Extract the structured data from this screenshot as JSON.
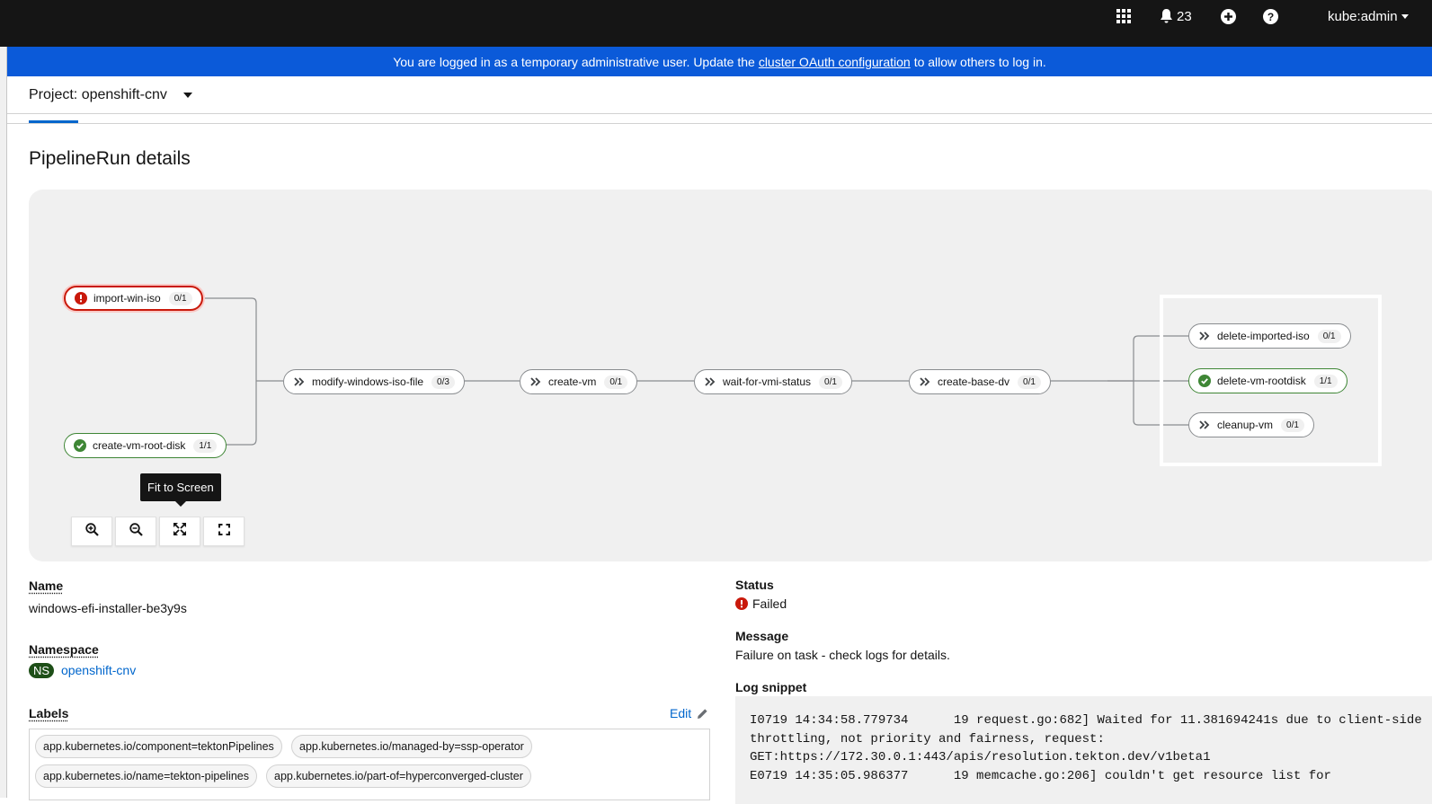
{
  "masthead": {
    "notifications_count": "23",
    "user": "kube:admin",
    "icons": [
      "app-launcher-icon",
      "bell-icon",
      "plus-circle-icon",
      "help-icon"
    ]
  },
  "banner": {
    "text_before": "You are logged in as a temporary administrative user. Update the",
    "link": "cluster OAuth configuration",
    "text_after": "to allow others to log in.",
    "color": "#0b5ad9"
  },
  "project": {
    "label": "Project: openshift-cnv"
  },
  "page": {
    "title": "PipelineRun details"
  },
  "pipeline": {
    "nodes": [
      {
        "name": "import-win-iso",
        "count": "0/1",
        "status": "failed"
      },
      {
        "name": "create-vm-root-disk",
        "count": "1/1",
        "status": "succeeded"
      },
      {
        "name": "modify-windows-iso-file",
        "count": "0/3",
        "status": "skipped"
      },
      {
        "name": "create-vm",
        "count": "0/1",
        "status": "skipped"
      },
      {
        "name": "wait-for-vmi-status",
        "count": "0/1",
        "status": "skipped"
      },
      {
        "name": "create-base-dv",
        "count": "0/1",
        "status": "skipped"
      },
      {
        "name": "delete-imported-iso",
        "count": "0/1",
        "status": "skipped"
      },
      {
        "name": "delete-vm-rootdisk",
        "count": "1/1",
        "status": "succeeded"
      },
      {
        "name": "cleanup-vm",
        "count": "0/1",
        "status": "skipped"
      }
    ],
    "tooltip": "Fit to Screen",
    "controls": [
      "zoom-in",
      "zoom-out",
      "fit-to-screen",
      "reset-view"
    ]
  },
  "details": {
    "name_label": "Name",
    "name_value": "windows-efi-installer-be3y9s",
    "namespace_label": "Namespace",
    "namespace_badge": "NS",
    "namespace_value": "openshift-cnv",
    "labels_label": "Labels",
    "edit_label": "Edit",
    "labels": [
      "app.kubernetes.io/component=tektonPipelines",
      "app.kubernetes.io/managed-by=ssp-operator",
      "app.kubernetes.io/name=tekton-pipelines",
      "app.kubernetes.io/part-of=hyperconverged-cluster"
    ],
    "status_label": "Status",
    "status_value": "Failed",
    "message_label": "Message",
    "message_value": "Failure on task - check logs for details.",
    "log_label": "Log snippet",
    "log_text": "I0719 14:34:58.779734      19 request.go:682] Waited for 11.381694241s due to client-side throttling, not priority and fairness, request: GET:https://172.30.0.1:443/apis/resolution.tekton.dev/v1beta1\nE0719 14:35:05.986377      19 memcache.go:206] couldn't get resource list for"
  },
  "colors": {
    "failed": "#c9190b",
    "succeeded": "#3e8635",
    "link": "#0066cc",
    "masthead": "#151515"
  }
}
